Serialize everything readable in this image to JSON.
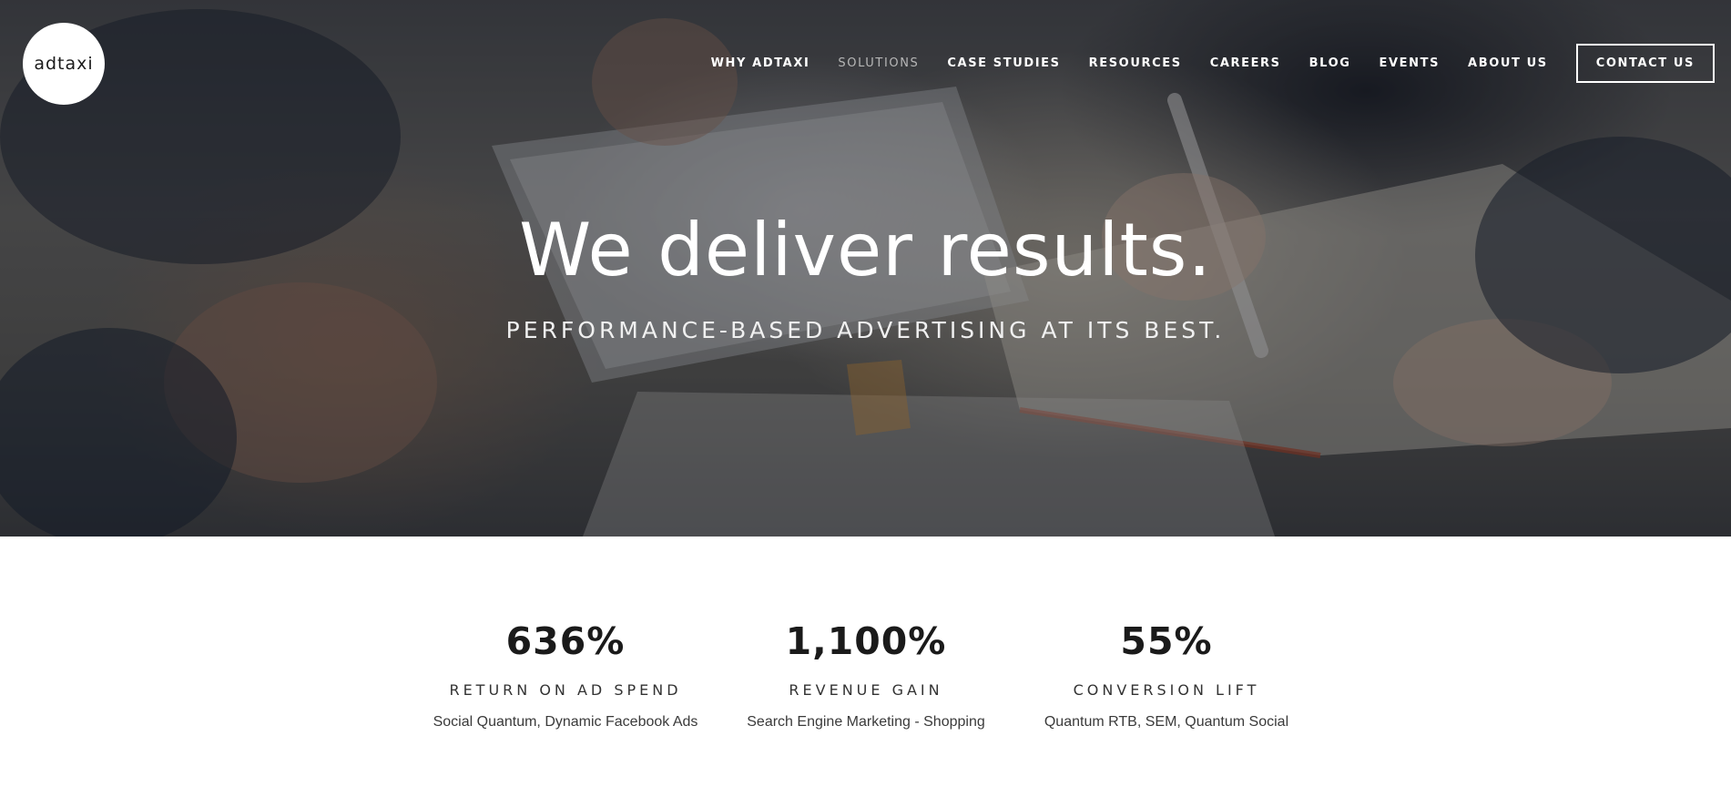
{
  "brand": {
    "logo_text": "adtaxi"
  },
  "nav": {
    "items": [
      {
        "label": "WHY ADTAXI",
        "state": "default"
      },
      {
        "label": "SOLUTIONS",
        "state": "muted"
      },
      {
        "label": "CASE STUDIES",
        "state": "default"
      },
      {
        "label": "RESOURCES",
        "state": "default"
      },
      {
        "label": "CAREERS",
        "state": "default"
      },
      {
        "label": "BLOG",
        "state": "default"
      },
      {
        "label": "EVENTS",
        "state": "default"
      },
      {
        "label": "ABOUT US",
        "state": "default"
      }
    ],
    "contact_label": "CONTACT US"
  },
  "hero": {
    "headline": "We deliver results.",
    "subheadline": "PERFORMANCE-BASED ADVERTISING AT ITS BEST."
  },
  "stats": [
    {
      "value": "636%",
      "label": "RETURN ON AD SPEND",
      "description": "Social Quantum, Dynamic Facebook Ads"
    },
    {
      "value": "1,100%",
      "label": "REVENUE GAIN",
      "description": "Search Engine Marketing - Shopping"
    },
    {
      "value": "55%",
      "label": "CONVERSION LIFT",
      "description": "Quantum RTB, SEM, Quantum Social"
    }
  ],
  "colors": {
    "text_dark": "#1a1a1a",
    "nav_text": "#ffffff",
    "nav_muted": "#b7b7b7",
    "background": "#ffffff"
  }
}
